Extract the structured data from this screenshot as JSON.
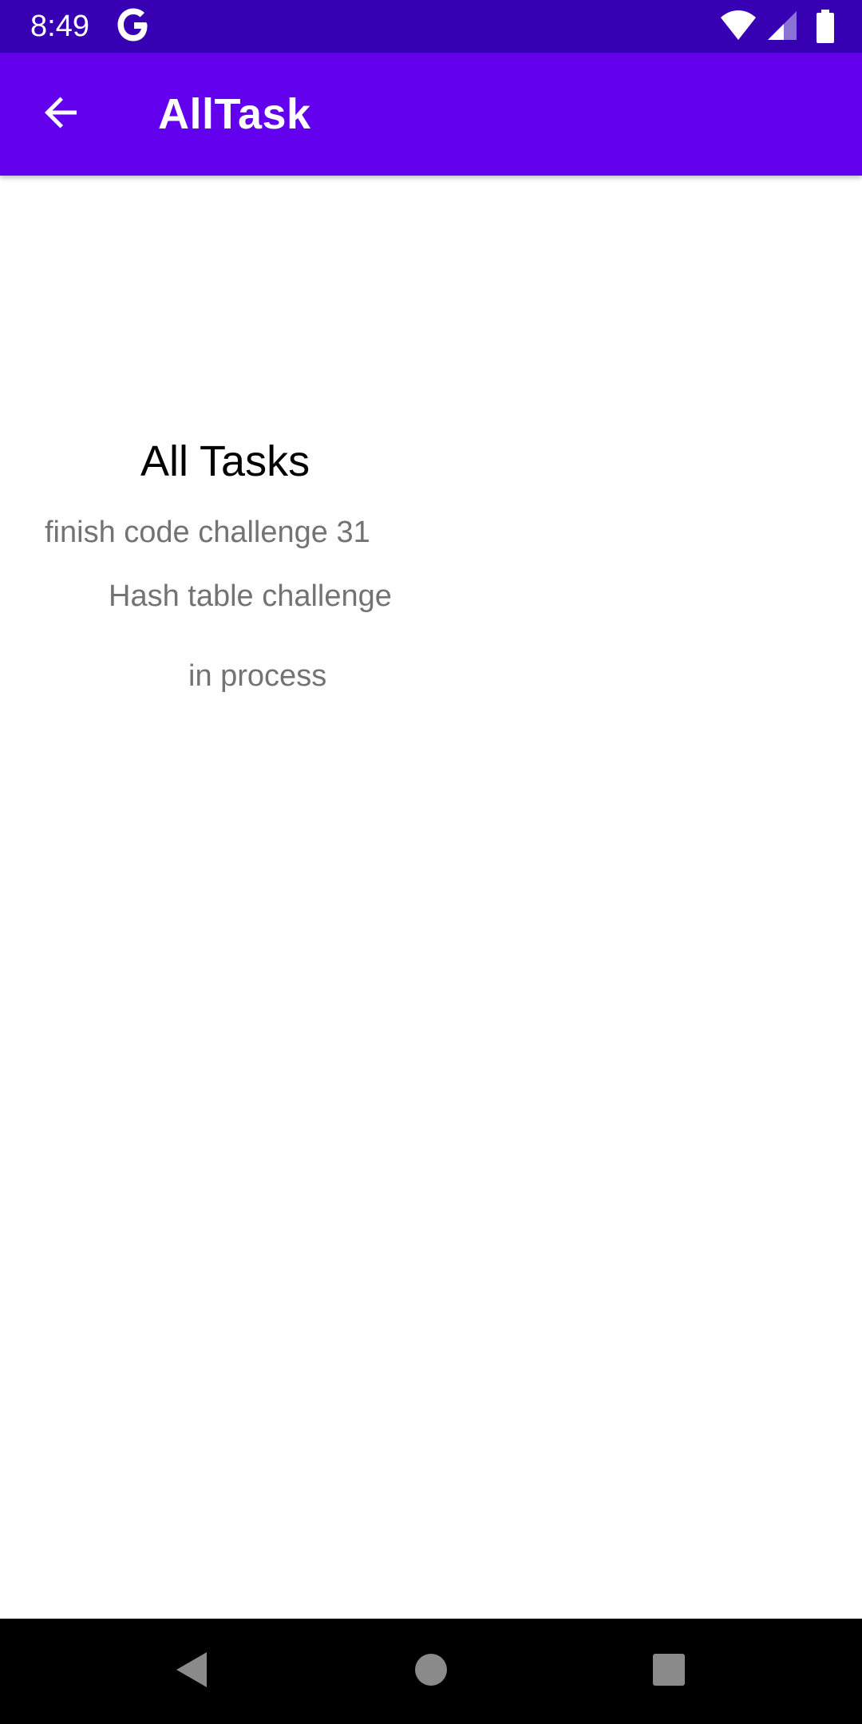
{
  "status_bar": {
    "time": "8:49",
    "icons": [
      "google-icon",
      "wifi-icon",
      "cell-signal-icon",
      "battery-icon"
    ]
  },
  "app_bar": {
    "title": "AllTask",
    "back_icon": "arrow-back-icon",
    "background": "#6200EE"
  },
  "main": {
    "heading": "All Tasks",
    "task": {
      "title": "finish code challenge 31",
      "body": "Hash table challenge",
      "state": "in process"
    }
  },
  "nav_bar": {
    "buttons": [
      "back-triangle-icon",
      "home-circle-icon",
      "recents-square-icon"
    ]
  },
  "colors": {
    "status_bar": "#3700B3",
    "primary": "#6200EE",
    "secondary_text": "#737373"
  }
}
